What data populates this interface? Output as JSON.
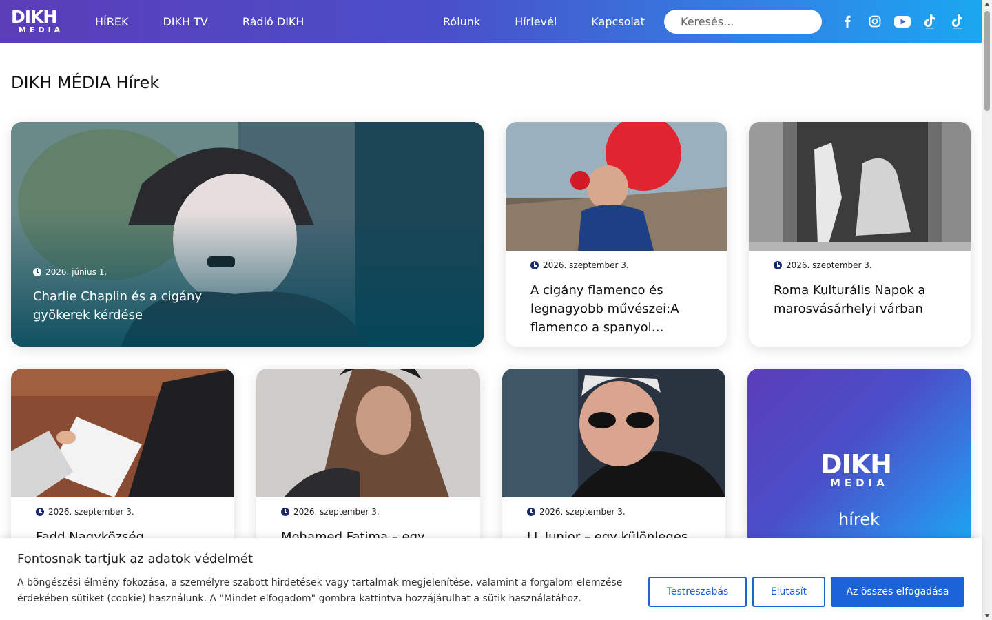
{
  "header": {
    "logo_top": "DIKH",
    "logo_bottom": "MEDIA",
    "nav_left": [
      "HÍREK",
      "DIKH TV",
      "Rádió DIKH"
    ],
    "nav_right": [
      "Rólunk",
      "Hírlevél",
      "Kapcsolat"
    ],
    "search_placeholder": "Keresés...",
    "socials": [
      "facebook-icon",
      "instagram-icon",
      "youtube-icon",
      "tiktok-icon",
      "tiktok-icon"
    ]
  },
  "page": {
    "title": "DIKH MÉDIA Hírek"
  },
  "articles": [
    {
      "date": "2026. június 1.",
      "title": "Charlie Chaplin és a cigány gyökerek kérdése"
    },
    {
      "date": "2026. szeptember 3.",
      "title": "A cigány flamenco és legnagyobb művészei:A flamenco a spanyol kultúr..."
    },
    {
      "date": "2026. szeptember 3.",
      "title": "Roma Kulturális Napok a marosvásárhelyi várban"
    },
    {
      "date": "2026. szeptember 3.",
      "title": "Fadd Nagyközség"
    },
    {
      "date": "2026. szeptember 3.",
      "title": "Mohamed Fatima – egy"
    },
    {
      "date": "2026. szeptember 3.",
      "title": "LL Junior – egy különleges"
    }
  ],
  "promo": {
    "logo_top": "DIKH",
    "logo_bottom": "MEDIA",
    "text": "hírek"
  },
  "cookie": {
    "title": "Fontosnak tartjuk az adatok védelmét",
    "text": "A böngészési élmény fokozása, a személyre szabott hirdetések vagy tartalmak megjelenítése, valamint a forgalom elemzése érdekében sütiket (cookie) használunk. A \"Mindet elfogadom\" gombra kattintva hozzájárulhat a sütik használatához.",
    "customize": "Testreszabás",
    "reject": "Elutasít",
    "accept_all": "Az összes elfogadása"
  },
  "colors": {
    "brand_start": "#5b3db8",
    "brand_end": "#1aa7f0",
    "button_blue": "#1d63d8"
  }
}
